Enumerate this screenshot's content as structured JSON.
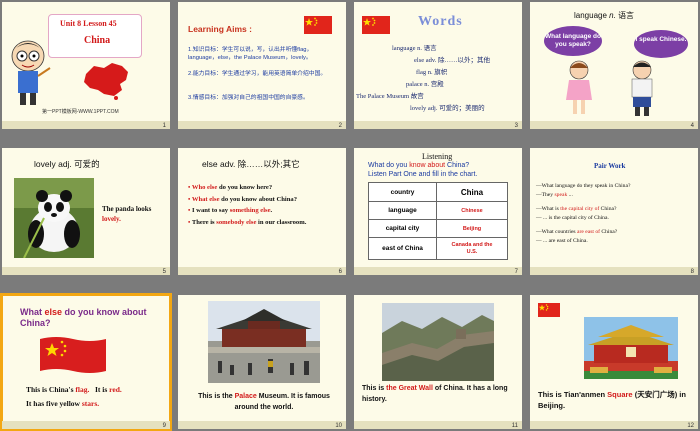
{
  "slides": [
    {
      "number": "1",
      "title_line1": "Unit 8 Lesson 45",
      "title_line2": "China",
      "footer": "第一PPT模板网-WWW.1PPT.COM"
    },
    {
      "number": "2",
      "heading": "Learning Aims :",
      "items": [
        "1.知识目标：学生可以说，写，认出并听懂flag，language，else，the Palace Museum，lovely。",
        "2.能力目标：学生通过学习，能用英语简单介绍中国。",
        "3.情感目标：加强对自己的祖国中国的自豪感。"
      ]
    },
    {
      "number": "3",
      "heading": "Words",
      "lines": [
        "language n. 语言",
        "else adv. 除……以外；其他",
        "flag n. 旗帜",
        "palace n. 宫殿",
        "The Palace Museum 故宫",
        "lovely adj. 可爱的；美丽的"
      ]
    },
    {
      "number": "4",
      "heading_word": "language",
      "heading_pos": "n.",
      "heading_cn": "语言",
      "bubble_left": "What language do you speak?",
      "bubble_right": "I speak Chinese."
    },
    {
      "number": "5",
      "heading": "lovely adj. 可爱的",
      "caption_prefix": "The panda looks ",
      "caption_key": "lovely."
    },
    {
      "number": "6",
      "heading": "else adv. 除……以外;其它",
      "bullets": [
        {
          "pre": "Who else",
          "post": " do you know here?"
        },
        {
          "pre": "What  else",
          "post": " do you know about China?"
        },
        {
          "pre": "I want to say ",
          "key": "something else",
          "post": "."
        },
        {
          "pre": "There is ",
          "key": "somebody else",
          "post": " in our classroom."
        }
      ]
    },
    {
      "number": "7",
      "heading": "Listening",
      "question_pre": "What do you ",
      "question_key": "know about",
      "question_post": " China?",
      "instruction": "Listen Part One and fill in the chart.",
      "table": [
        [
          "country",
          "China"
        ],
        [
          "language",
          "Chinese"
        ],
        [
          "capital city",
          "Beijing"
        ],
        [
          "east of China",
          "Canada and the U.S."
        ]
      ]
    },
    {
      "number": "8",
      "heading": "Pair Work",
      "lines": [
        {
          "text": "—What language do they speak in China?"
        },
        {
          "pre": "—They ",
          "key": "speak",
          "post": " ..."
        },
        {
          "pre": "—What is ",
          "key": "the capital city of",
          "post": " China?"
        },
        {
          "text": "— ... is the capital city of China."
        },
        {
          "pre": "—What countries ",
          "key": "are east of",
          "post": " China?"
        },
        {
          "text": "— ... are east of China."
        }
      ]
    },
    {
      "number": "9",
      "heading_pre": "What ",
      "heading_key": "else",
      "heading_post": " do you know about China?",
      "line1_pre": "This is China's ",
      "line1_key": "flag.",
      "line1_mid": "   It is ",
      "line1_key2": "red.",
      "line2_pre": "It has five yellow ",
      "line2_key": "stars."
    },
    {
      "number": "10",
      "caption_pre": "This is the ",
      "caption_key": "Palace",
      "caption_post": " Museum. It is famous around the world."
    },
    {
      "number": "11",
      "caption_pre": "This is ",
      "caption_key": "the Great Wall",
      "caption_post": " of China. It has a long history."
    },
    {
      "number": "12",
      "caption_pre": "This is Tian'anmen ",
      "caption_key": "Square",
      "caption_post": " (天安门广场) in Beijing."
    }
  ],
  "colors": {
    "accent_red": "#d21a1a",
    "slide_bg": "#fdfbe8",
    "canvas_bg": "#7b7b7b",
    "selection": "#f3a712"
  }
}
